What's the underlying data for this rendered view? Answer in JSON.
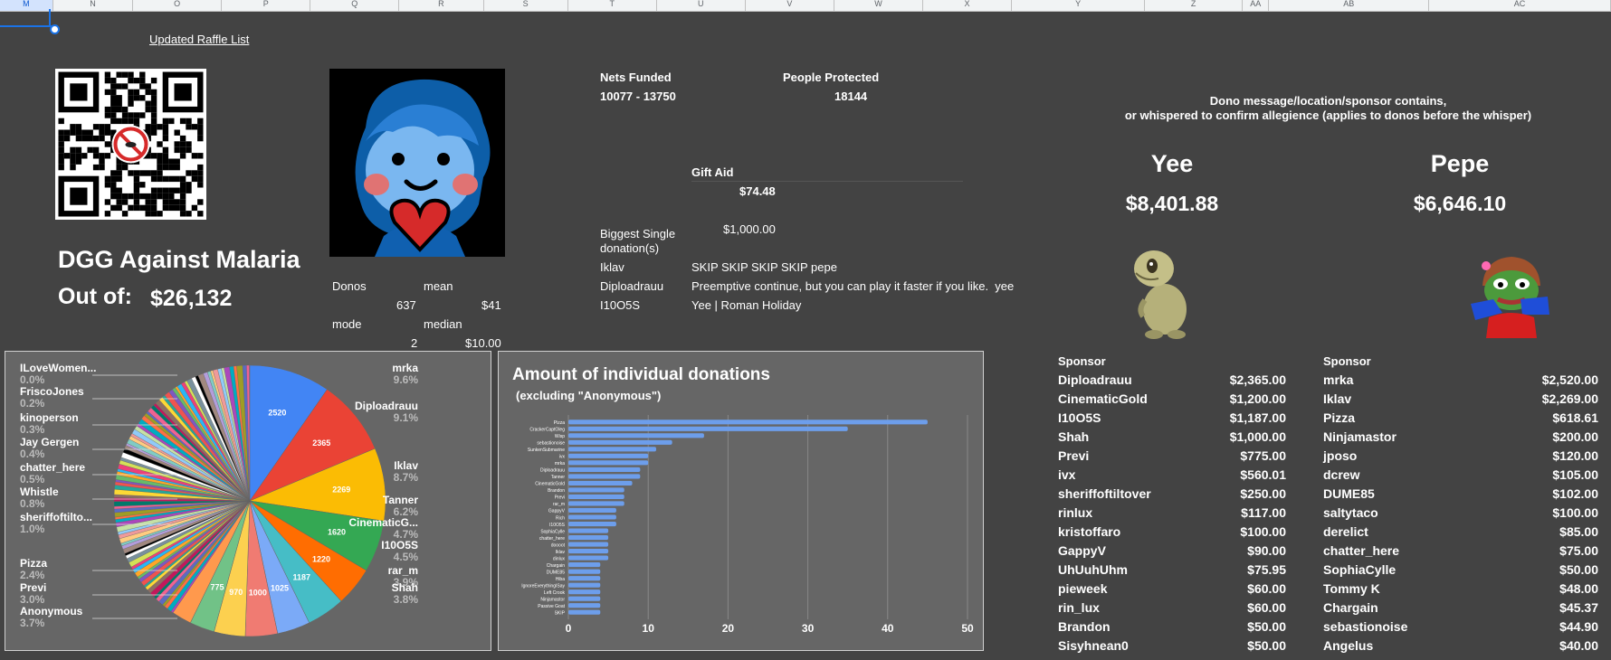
{
  "column_headers": [
    "M",
    "N",
    "O",
    "P",
    "Q",
    "R",
    "S",
    "T",
    "U",
    "V",
    "W",
    "X",
    "Y",
    "Z",
    "AA",
    "AB",
    "AC"
  ],
  "raffle_link": "Updated Raffle List",
  "title": "DGG Against Malaria",
  "out_of_label": "Out of:",
  "out_of_value": "$26,132",
  "stats": {
    "donos_label": "Donos",
    "mean_label": "mean",
    "donos_value": "637",
    "mean_value": "$41",
    "mode_label": "mode",
    "median_label": "median",
    "mode_value": "2",
    "median_value": "$10.00"
  },
  "nets": {
    "nets_label": "Nets Funded",
    "nets_value": "10077 - 13750",
    "people_label": "People Protected",
    "people_value": "18144",
    "gift_aid_label": "Gift Aid",
    "gift_aid_value": "$74.48",
    "biggest_label": "Biggest Single donation(s)",
    "biggest_value": "$1,000.00"
  },
  "biggest_donors": [
    {
      "name": "Iklav",
      "message": "SKIP SKIP SKIP SKIP pepe"
    },
    {
      "name": "Diploadrauu",
      "message": "Preemptive continue, but you can play it faster if you like.  yee"
    },
    {
      "name": "I10O5S",
      "message": "Yee | Roman Holiday"
    }
  ],
  "allegiance_note_1": "Dono message/location/sponsor contains,",
  "allegiance_note_2": "or whispered to confirm allegience (applies to donos before the whisper)",
  "teams": {
    "yee_label": "Yee",
    "yee_total": "$8,401.88",
    "pepe_label": "Pepe",
    "pepe_total": "$6,646.10"
  },
  "yee_sponsors": {
    "header": "Sponsor",
    "rows": [
      {
        "name": "Diploadrauu",
        "amount": "$2,365.00"
      },
      {
        "name": "CinematicGold",
        "amount": "$1,200.00"
      },
      {
        "name": "I10O5S",
        "amount": "$1,187.00"
      },
      {
        "name": "Shah",
        "amount": "$1,000.00"
      },
      {
        "name": "Previ",
        "amount": "$775.00"
      },
      {
        "name": "ivx",
        "amount": "$560.01"
      },
      {
        "name": "sheriffoftiltover",
        "amount": "$250.00"
      },
      {
        "name": "rinlux",
        "amount": "$117.00"
      },
      {
        "name": "kristoffaro",
        "amount": "$100.00"
      },
      {
        "name": "GappyV",
        "amount": "$90.00"
      },
      {
        "name": "UhUuhUhm",
        "amount": "$75.95"
      },
      {
        "name": "pieweek",
        "amount": "$60.00"
      },
      {
        "name": "rin_lux",
        "amount": "$60.00"
      },
      {
        "name": "Brandon",
        "amount": "$50.00"
      },
      {
        "name": "Sisyhnean0",
        "amount": "$50.00"
      }
    ]
  },
  "pepe_sponsors": {
    "header": "Sponsor",
    "rows": [
      {
        "name": "mrka",
        "amount": "$2,520.00"
      },
      {
        "name": "Iklav",
        "amount": "$2,269.00"
      },
      {
        "name": "Pizza",
        "amount": "$618.61"
      },
      {
        "name": "Ninjamastor",
        "amount": "$200.00"
      },
      {
        "name": "jposo",
        "amount": "$120.00"
      },
      {
        "name": "dcrew",
        "amount": "$105.00"
      },
      {
        "name": "DUME85",
        "amount": "$102.00"
      },
      {
        "name": "saltytaco",
        "amount": "$100.00"
      },
      {
        "name": "derelict",
        "amount": "$85.00"
      },
      {
        "name": "chatter_here",
        "amount": "$75.00"
      },
      {
        "name": "SophiaCylle",
        "amount": "$50.00"
      },
      {
        "name": "Tommy K",
        "amount": "$48.00"
      },
      {
        "name": "Chargain",
        "amount": "$45.37"
      },
      {
        "name": "sebastionoise",
        "amount": "$44.90"
      },
      {
        "name": "Angelus",
        "amount": "$40.00"
      }
    ]
  },
  "chart_data": [
    {
      "type": "pie",
      "slices": [
        {
          "name": "mrka",
          "value": 2520,
          "percent": "9.6%",
          "color": "#4285f4"
        },
        {
          "name": "Diploadrauu",
          "value": 2365,
          "percent": "9.1%",
          "color": "#ea4335"
        },
        {
          "name": "Iklav",
          "value": 2269,
          "percent": "8.7%",
          "color": "#fbbc04"
        },
        {
          "name": "Tanner",
          "value": 1620,
          "percent": "6.2%",
          "color": "#34a853"
        },
        {
          "name": "CinematicG...",
          "value": 1220,
          "percent": "4.7%",
          "color": "#ff6d01"
        },
        {
          "name": "I10O5S",
          "value": 1187,
          "percent": "4.5%",
          "color": "#46bdc6"
        },
        {
          "name": "rar_m",
          "value": 1025,
          "percent": "3.9%",
          "color": "#7baaf7"
        },
        {
          "name": "Shah",
          "value": 1000,
          "percent": "3.8%",
          "color": "#f07b72"
        },
        {
          "name": "Anonymous",
          "value": 970,
          "percent": "3.7%",
          "color": "#fcd04f"
        },
        {
          "name": "Previ",
          "value": 775,
          "percent": "3.0%",
          "color": "#71c287"
        },
        {
          "name": "Pizza",
          "value": 618,
          "percent": "2.4%",
          "color": "#ff994d"
        }
      ],
      "labels": [
        {
          "name": "ILoveWomen...",
          "percent": "0.0%"
        },
        {
          "name": "FriscoJones",
          "percent": "0.2%"
        },
        {
          "name": "kinoperson",
          "percent": "0.3%"
        },
        {
          "name": "Jay Gergen",
          "percent": "0.4%"
        },
        {
          "name": "chatter_here",
          "percent": "0.5%"
        },
        {
          "name": "Whistle",
          "percent": "0.8%"
        },
        {
          "name": "sheriffoftilto...",
          "percent": "1.0%"
        }
      ],
      "other_total": 10563
    },
    {
      "type": "bar",
      "title": "Amount of individual donations",
      "subtitle": "(excluding \"Anonymous\")",
      "categories": [
        "Pizza",
        "CrackerCaptOleg",
        "Wisp",
        "sebastionoise",
        "SunkenSubmarine",
        "ivx",
        "mrka",
        "Diploadrauu",
        "Tanner",
        "CinematicGold",
        "Brandon",
        "Previ",
        "rar_m",
        "GappyV",
        "Rich",
        "I10O5S",
        "SophiaCylle",
        "chatter_here",
        "doooot",
        "Iklav",
        "dinlux",
        "Chargain",
        "DUME85",
        "Hiba",
        "IgnoreEverythingISay",
        "Left Crook",
        "Ninjamastor",
        "Passive Goat",
        "SKIP"
      ],
      "values": [
        45,
        35,
        17,
        13,
        11,
        10,
        10,
        9,
        9,
        8,
        7,
        7,
        7,
        6,
        6,
        6,
        5,
        5,
        5,
        5,
        5,
        4,
        4,
        4,
        4,
        4,
        4,
        4,
        4
      ],
      "xlim": [
        0,
        50
      ],
      "xticks": [
        "0",
        "10",
        "20",
        "30",
        "40",
        "50"
      ],
      "color": "#6d9eeb"
    }
  ]
}
